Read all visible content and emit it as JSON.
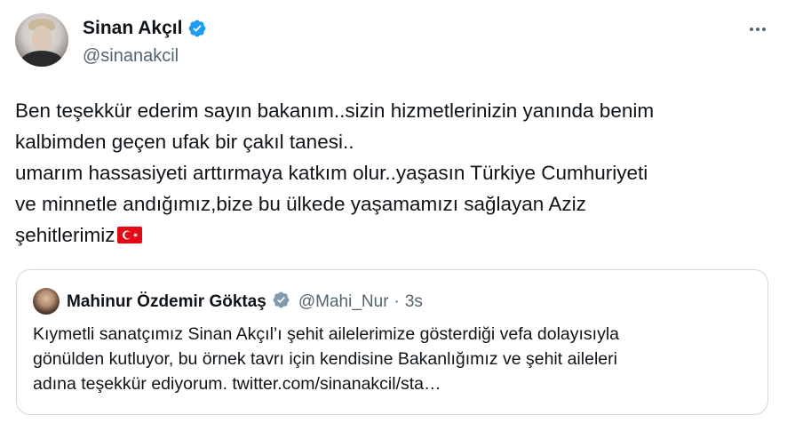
{
  "author": {
    "display_name": "Sinan Akçıl",
    "handle": "@sinanakcil",
    "verified": true
  },
  "tweet": {
    "text": "Ben teşekkür ederim sayın bakanım..sizin hizmetlerinizin yanında benim\nkalbimden geçen ufak bir çakıl tanesi..\numarım hassasiyeti arttırmaya katkım olur..yaşasın Türkiye Cumhuriyeti\nve minnetle andığımız,bize bu ülkede yaşamamızı sağlayan Aziz\nşehitlerimiz",
    "emoji": "turkey-flag"
  },
  "quoted_tweet": {
    "display_name": "Mahinur Özdemir Göktaş",
    "handle": "@Mahi_Nur",
    "separator": "·",
    "time": "3s",
    "verified_badge": "government-gray",
    "text": "Kıymetli sanatçımız Sinan Akçıl’ı şehit ailelerimize gösterdiği vefa dolayısıyla\ngönülden kutluyor, bu örnek tavrı için kendisine Bakanlığımız ve şehit aileleri\nadına teşekkür ediyorum. twitter.com/sinanakcil/sta…"
  },
  "colors": {
    "verified_blue": "#1d9bf0",
    "verified_gray": "#829aab",
    "secondary_text": "#536471",
    "border": "#cfd9de"
  }
}
